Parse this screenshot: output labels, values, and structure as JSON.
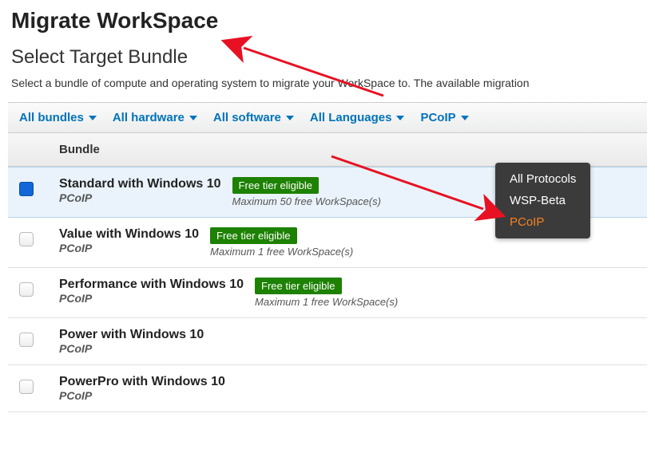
{
  "page_title": "Migrate WorkSpace",
  "section_title": "Select Target Bundle",
  "section_desc": "Select a bundle of compute and operating system to migrate your WorkSpace to. The available migration",
  "filters": {
    "bundles": "All bundles",
    "hardware": "All hardware",
    "software": "All software",
    "languages": "All Languages",
    "protocol": "PCoIP"
  },
  "table": {
    "header_bundle": "Bundle"
  },
  "protocol_menu": {
    "all": "All Protocols",
    "wsp": "WSP-Beta",
    "pcoip": "PCoIP"
  },
  "free_badge": "Free tier eligible",
  "rows": [
    {
      "name": "Standard with Windows 10",
      "proto": "PCoIP",
      "free": true,
      "note": "Maximum 50 free WorkSpace(s)",
      "selected": true
    },
    {
      "name": "Value with Windows 10",
      "proto": "PCoIP",
      "free": true,
      "note": "Maximum 1 free WorkSpace(s)",
      "selected": false
    },
    {
      "name": "Performance with Windows 10",
      "proto": "PCoIP",
      "free": true,
      "note": "Maximum 1 free WorkSpace(s)",
      "selected": false
    },
    {
      "name": "Power with Windows 10",
      "proto": "PCoIP",
      "free": false,
      "note": "",
      "selected": false
    },
    {
      "name": "PowerPro with Windows 10",
      "proto": "PCoIP",
      "free": false,
      "note": "",
      "selected": false
    }
  ],
  "colors": {
    "link": "#0073bb",
    "badge_bg": "#1d8102",
    "selected_bg": "#eaf3fb",
    "menu_active": "#f58220",
    "annotation": "#e81123"
  }
}
